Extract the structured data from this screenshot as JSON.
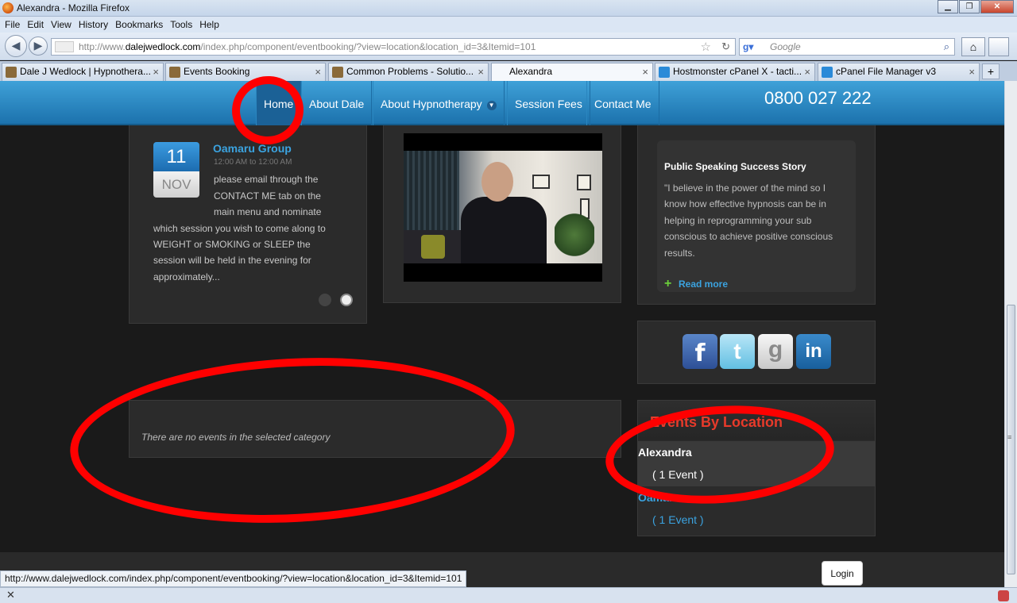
{
  "window": {
    "title": "Alexandra - Mozilla Firefox",
    "minimize": "▁",
    "maximize": "❐",
    "close": "✕"
  },
  "menu": [
    "File",
    "Edit",
    "View",
    "History",
    "Bookmarks",
    "Tools",
    "Help"
  ],
  "address": {
    "prefix": "http://www.",
    "domain": "dalejwedlock.com",
    "path": "/index.php/component/eventbooking/?view=location&location_id=3&Itemid=101"
  },
  "search": {
    "engine_icon": "google-icon",
    "placeholder": "Google"
  },
  "tabs": [
    {
      "label": "Dale J Wedlock | Hypnothera...",
      "active": false
    },
    {
      "label": "Events Booking",
      "active": false
    },
    {
      "label": "Common Problems - Solutio...",
      "active": false
    },
    {
      "label": "Alexandra",
      "active": true
    },
    {
      "label": "Hostmonster cPanel X - tacti...",
      "active": false
    },
    {
      "label": "cPanel File Manager v3",
      "active": false
    }
  ],
  "site_nav": {
    "items": [
      "Home",
      "About Dale",
      "About Hypnotherapy",
      "Session Fees",
      "Contact Me"
    ],
    "phone": "0800 027 222"
  },
  "event": {
    "day": "11",
    "month": "NOV",
    "title": "Oamaru Group",
    "time": "12:00 AM to 12:00 AM",
    "text_lines": [
      "please email through the",
      "CONTACT ME tab on the",
      "main menu and nominate",
      "which session you wish to come along to",
      "WEIGHT or SMOKING or SLEEP the",
      "session will be held in the evening for",
      "approximately..."
    ]
  },
  "story": {
    "title": "Public Speaking Success Story",
    "lines": [
      "\"I believe in the power of the mind so I",
      "know how effective hypnosis can be in",
      "helping in reprogramming your sub",
      "conscious to achieve positive conscious",
      "results."
    ],
    "read_more": "Read more"
  },
  "social": {
    "facebook": "f",
    "twitter": "t",
    "google": "g",
    "linkedin": "in"
  },
  "no_events": "There are no events in the selected category",
  "locations": {
    "header": "Events By Location",
    "items": [
      {
        "name": "Alexandra",
        "count": "( 1 Event )",
        "active": true
      },
      {
        "name": "Oamaru",
        "count": "( 1 Event )",
        "active": false
      }
    ]
  },
  "footer": {
    "login": "Login",
    "status_url": "http://www.dalejwedlock.com/index.php/component/eventbooking/?view=location&location_id=3&Itemid=101"
  },
  "colors": {
    "nav_blue": "#1c72ad",
    "link_blue": "#3ba3e0",
    "annotation_red": "#ff0000",
    "page_bg": "#1a1a1a"
  }
}
